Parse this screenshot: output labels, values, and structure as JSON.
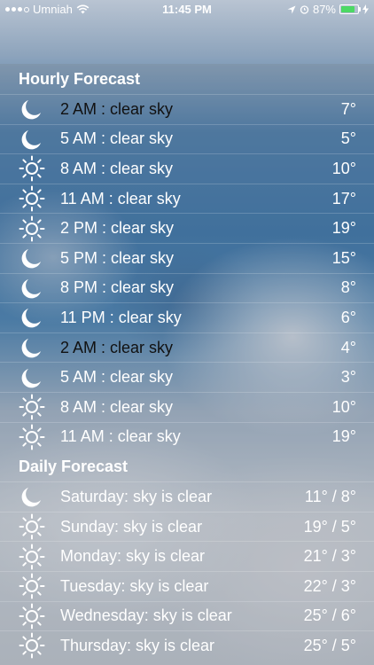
{
  "status_bar": {
    "carrier": "Umniah",
    "time": "11:45 PM",
    "battery": "87%",
    "battery_level": 0.87
  },
  "hourly": {
    "title": "Hourly Forecast",
    "items": [
      {
        "icon": "moon-icon",
        "label": "2 AM : clear sky",
        "temp": "7°"
      },
      {
        "icon": "moon-icon",
        "label": "5 AM : clear sky",
        "temp": "5°"
      },
      {
        "icon": "sun-icon",
        "label": "8 AM : clear sky",
        "temp": "10°"
      },
      {
        "icon": "sun-icon",
        "label": "11 AM : clear sky",
        "temp": "17°"
      },
      {
        "icon": "sun-icon",
        "label": "2 PM : clear sky",
        "temp": "19°"
      },
      {
        "icon": "moon-icon",
        "label": "5 PM : clear sky",
        "temp": "15°"
      },
      {
        "icon": "moon-icon",
        "label": "8 PM : clear sky",
        "temp": "8°"
      },
      {
        "icon": "moon-icon",
        "label": "11 PM : clear sky",
        "temp": "6°"
      },
      {
        "icon": "moon-icon",
        "label": "2 AM : clear sky",
        "temp": "4°"
      },
      {
        "icon": "moon-icon",
        "label": "5 AM : clear sky",
        "temp": "3°"
      },
      {
        "icon": "sun-icon",
        "label": "8 AM : clear sky",
        "temp": "10°"
      },
      {
        "icon": "sun-icon",
        "label": "11 AM : clear sky",
        "temp": "19°"
      }
    ]
  },
  "daily": {
    "title": "Daily Forecast",
    "items": [
      {
        "icon": "moon-icon",
        "label": "Saturday: sky is clear",
        "temp": "11° / 8°"
      },
      {
        "icon": "sun-icon",
        "label": "Sunday: sky is clear",
        "temp": "19° / 5°"
      },
      {
        "icon": "sun-icon",
        "label": "Monday: sky is clear",
        "temp": "21° / 3°"
      },
      {
        "icon": "sun-icon",
        "label": "Tuesday: sky is clear",
        "temp": "22° / 3°"
      },
      {
        "icon": "sun-icon",
        "label": "Wednesday: sky is clear",
        "temp": "25° / 6°"
      },
      {
        "icon": "sun-icon",
        "label": "Thursday: sky is clear",
        "temp": "25° / 5°"
      }
    ]
  }
}
